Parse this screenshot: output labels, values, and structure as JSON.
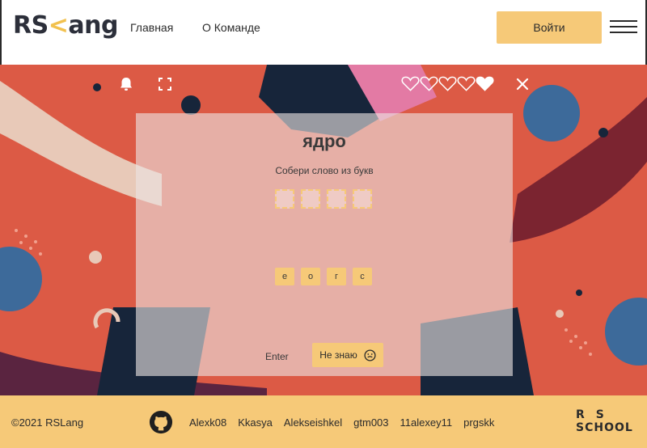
{
  "header": {
    "logo_text_a": "RS",
    "logo_text_b": "ang",
    "nav": [
      {
        "label": "Главная"
      },
      {
        "label": "О Команде"
      }
    ],
    "login_label": "Войти"
  },
  "game": {
    "lives_total": 5,
    "lives_remaining": 1,
    "word": "ядро",
    "instruction": "Собери слово из букв",
    "slots_count": 4,
    "letters": [
      "е",
      "о",
      "г",
      "с"
    ],
    "enter_label": "Enter",
    "dont_know_label": "Не знаю"
  },
  "footer": {
    "copyright": "©2021 RSLang",
    "authors": [
      "Alexk08",
      "Kkasya",
      "Alekseishkel",
      "gtm003",
      "11alexey11",
      "prgskk"
    ],
    "school_logo_line1": "RS",
    "school_logo_line2": "SCHOOL"
  },
  "icons": {
    "bell": "bell-icon",
    "fullscreen": "fullscreen-icon",
    "close": "close-icon",
    "heart": "heart-icon",
    "smile": "smile-icon",
    "github": "github-icon"
  },
  "colors": {
    "accent": "#f6c978",
    "game_bg": "#dc5a45",
    "navy": "#17253a",
    "blue": "#3d6a9a"
  }
}
